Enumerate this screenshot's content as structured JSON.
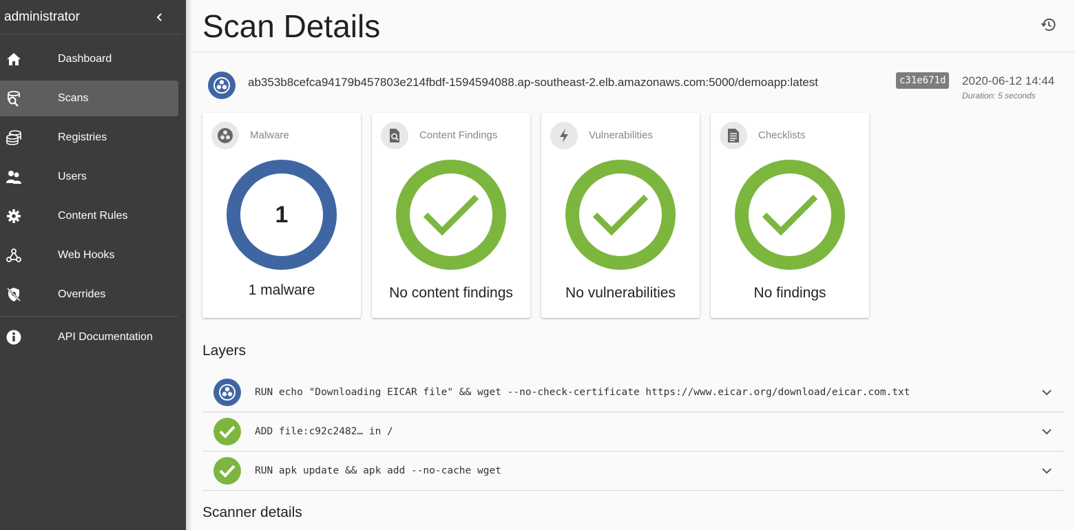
{
  "sidebar": {
    "username": "administrator",
    "items": [
      {
        "label": "Dashboard",
        "icon": "home-icon"
      },
      {
        "label": "Scans",
        "icon": "scan-search-icon",
        "active": true
      },
      {
        "label": "Registries",
        "icon": "database-icon"
      },
      {
        "label": "Users",
        "icon": "users-icon"
      },
      {
        "label": "Content Rules",
        "icon": "gear-icon"
      },
      {
        "label": "Web Hooks",
        "icon": "webhook-icon"
      },
      {
        "label": "Overrides",
        "icon": "override-icon"
      },
      {
        "label": "API Documentation",
        "icon": "info-icon"
      }
    ]
  },
  "header": {
    "title": "Scan Details"
  },
  "image": {
    "name": "ab353b8cefca94179b457803e214fbdf-1594594088.ap-southeast-2.elb.amazonaws.com:5000/demoapp:latest",
    "digest": "c31e671d",
    "date": "2020-06-12 14:44",
    "duration": "Duration: 5 seconds"
  },
  "cards": [
    {
      "title": "Malware",
      "icon": "biohazard-icon",
      "status": "count",
      "count": "1",
      "caption": "1 malware"
    },
    {
      "title": "Content Findings",
      "icon": "file-search-icon",
      "status": "ok",
      "caption": "No content findings"
    },
    {
      "title": "Vulnerabilities",
      "icon": "lightning-icon",
      "status": "ok",
      "caption": "No vulnerabilities"
    },
    {
      "title": "Checklists",
      "icon": "checklist-icon",
      "status": "ok",
      "caption": "No findings"
    }
  ],
  "layers_section": {
    "title": "Layers",
    "items": [
      {
        "command": "RUN echo \"Downloading EICAR file\" && wget --no-check-certificate https://www.eicar.org/download/eicar.com.txt",
        "status": "malware"
      },
      {
        "command": "ADD file:c92c2482… in /",
        "status": "ok"
      },
      {
        "command": "RUN apk update && apk add --no-cache wget",
        "status": "ok"
      }
    ]
  },
  "scanner_section": {
    "title": "Scanner details"
  },
  "colors": {
    "sidebar_bg": "#3c3c3c",
    "malware_blue": "#3f66a3",
    "ok_green": "#7cb63f",
    "badge_gray": "#7d7d7d"
  }
}
